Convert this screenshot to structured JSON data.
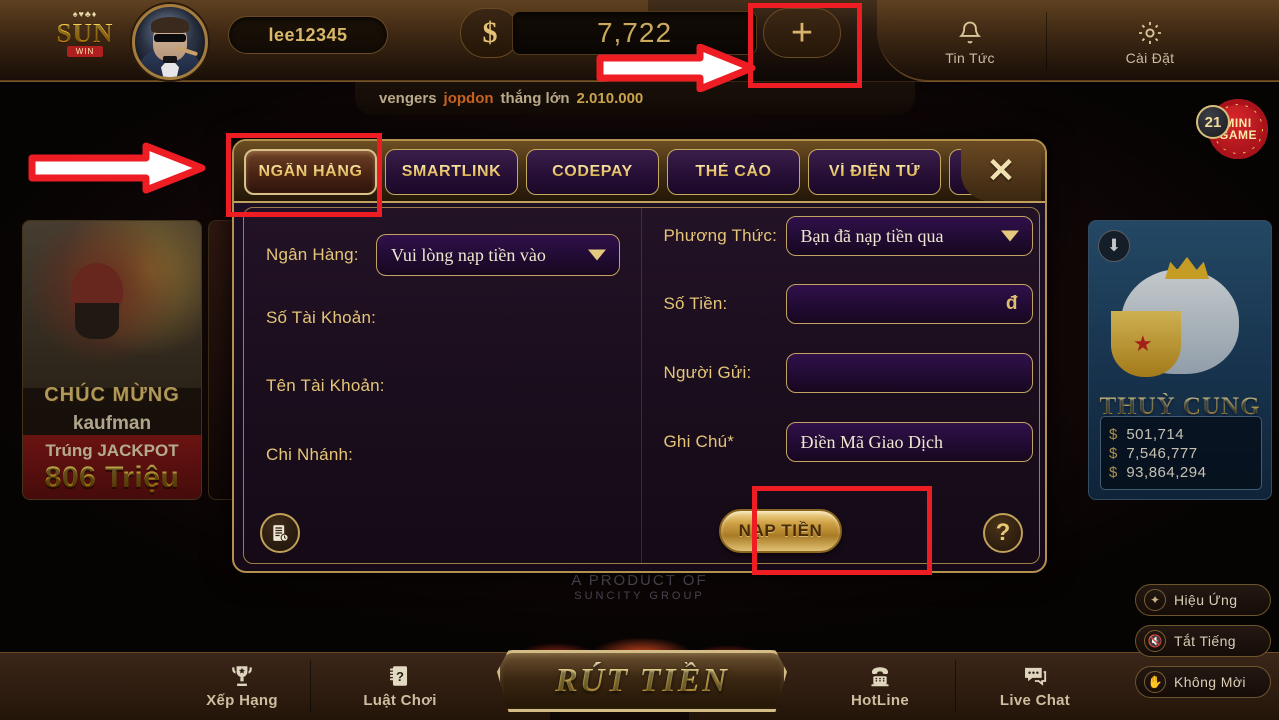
{
  "header": {
    "logo": {
      "cards": "♠♥♣♦",
      "name": "SUN",
      "ribbon": "WIN"
    },
    "username": "lee12345",
    "currency_symbol": "$",
    "balance": "7,722",
    "add_button_icon": "plus-icon",
    "items": [
      {
        "label": "Tin Tức",
        "icon": "bell-icon"
      },
      {
        "label": "Cài Đặt",
        "icon": "gear-icon"
      }
    ],
    "marquee": {
      "prefix": "vengers",
      "user": "jopdon",
      "middle": "thắng lớn",
      "amount": "2.010.000"
    },
    "minigame": {
      "number": "21",
      "line1": "MINI",
      "line2": "GAME"
    }
  },
  "left_card": {
    "congrats": "CHÚC MỪNG",
    "winner": "kaufman",
    "jackpot_text": "Trúng JACKPOT",
    "amount": "806 Triệu"
  },
  "right_card": {
    "title": "THUỲ CUNG",
    "download_icon": "download-icon",
    "jackpots": [
      {
        "symbol": "$",
        "value": "501,714"
      },
      {
        "symbol": "$",
        "value": "7,546,777"
      },
      {
        "symbol": "$",
        "value": "93,864,294"
      }
    ]
  },
  "modal": {
    "close_label": "✕",
    "tabs": [
      {
        "label": "NGÂN HÀNG",
        "active": true
      },
      {
        "label": "SMARTLINK",
        "active": false
      },
      {
        "label": "CODEPAY",
        "active": false
      },
      {
        "label": "THẺ CÀO",
        "active": false
      },
      {
        "label": "VÍ ĐIỆN TỬ",
        "active": false
      }
    ],
    "left_fields": [
      {
        "label": "Ngân Hàng:",
        "value": "Vui lòng nạp tiền vào",
        "type": "select"
      },
      {
        "label": "Số Tài Khoản:",
        "value": "",
        "type": "text"
      },
      {
        "label": "Tên Tài Khoản:",
        "value": "",
        "type": "text"
      },
      {
        "label": "Chi Nhánh:",
        "value": "",
        "type": "text"
      }
    ],
    "right_fields": [
      {
        "label": "Phương Thức:",
        "value": "Bạn đã nạp tiền qua",
        "type": "select",
        "suffix": ""
      },
      {
        "label": "Số Tiền:",
        "value": "",
        "type": "input",
        "suffix": "đ"
      },
      {
        "label": "Người Gửi:",
        "value": "",
        "type": "input",
        "suffix": ""
      },
      {
        "label": "Ghi Chú*",
        "value": "Điền Mã Giao Dịch",
        "type": "input",
        "suffix": ""
      }
    ],
    "submit_label": "NẠP TIỀN",
    "history_icon": "history-document-icon",
    "help_icon": "question-mark-icon"
  },
  "footer_brand": {
    "line1": "A PRODUCT OF",
    "line2": "SUNCITY GROUP"
  },
  "bottom": {
    "left_items": [
      {
        "label": "Xếp Hạng",
        "icon": "trophy-icon"
      },
      {
        "label": "Luật Chơi",
        "icon": "rulebook-icon"
      }
    ],
    "center_button": "RÚT TIỀN",
    "right_items": [
      {
        "label": "HotLine",
        "icon": "telephone-icon"
      },
      {
        "label": "Live Chat",
        "icon": "chat-bubble-icon"
      }
    ],
    "side_buttons": [
      {
        "label": "Hiệu Ứng",
        "icon": "magic-wand-icon"
      },
      {
        "label": "Tắt Tiếng",
        "icon": "mute-icon"
      },
      {
        "label": "Không Mời",
        "icon": "hand-icon"
      }
    ]
  },
  "annotations": {
    "color": "#ee1d23",
    "boxes": [
      "add-balance-button",
      "ngan-hang-tab",
      "nap-tien-button"
    ],
    "arrows": [
      "arrow-to-add-balance",
      "arrow-to-ngan-hang-tab"
    ]
  }
}
